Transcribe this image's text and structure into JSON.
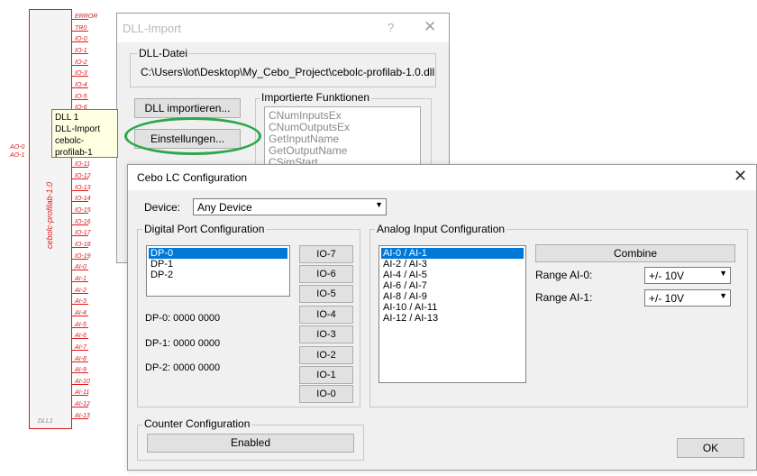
{
  "schematic": {
    "block_name": "cebolc-profilab-1.0",
    "footer": "DLL1",
    "right_pins": [
      "ERROR",
      "TR0",
      "IO-0",
      "IO-1",
      "IO-2",
      "IO-3",
      "IO-4",
      "IO-5",
      "IO-6",
      "IO-7",
      "IO-8",
      "IO-9",
      "IO-10",
      "IO-11",
      "IO-12",
      "IO-13",
      "IO-14",
      "IO-15",
      "IO-16",
      "IO-17",
      "IO-18",
      "IO-19",
      "AI-0",
      "AI-1",
      "AI-2",
      "AI-3",
      "AI-4",
      "AI-5",
      "AI-6",
      "AI-7",
      "AI-8",
      "AI-9",
      "AI-10",
      "AI-11",
      "AI-12",
      "AI-13"
    ],
    "left_pins": [
      "AO-0",
      "AO-1"
    ]
  },
  "tooltip": {
    "line1": "DLL 1",
    "line2": "DLL-Import",
    "line3": "cebolc-profilab-1"
  },
  "dll_dialog": {
    "title": "DLL-Import",
    "help": "?",
    "close": "✕",
    "file_group": "DLL-Datei",
    "path": "C:\\Users\\lot\\Desktop\\My_Cebo_Project\\cebolc-profilab-1.0.dll",
    "import_button": "DLL importieren...",
    "settings_button": "Einstellungen...",
    "functions_group": "Importierte Funktionen",
    "functions": [
      "CNumInputsEx",
      "CNumOutputsEx",
      "GetInputName",
      "GetOutputName",
      "CSimStart"
    ]
  },
  "cebo": {
    "title": "Cebo LC Configuration",
    "close": "✕",
    "device_label": "Device:",
    "device_value": "Any Device",
    "digital_group": "Digital Port Configuration",
    "dp_list": [
      "DP-0",
      "DP-1",
      "DP-2"
    ],
    "io_buttons": [
      "IO-7",
      "IO-6",
      "IO-5",
      "IO-4",
      "IO-3",
      "IO-2",
      "IO-1",
      "IO-0"
    ],
    "dp_states": [
      "DP-0: 0000 0000",
      "DP-1: 0000 0000",
      "DP-2: 0000 0000"
    ],
    "analog_group": "Analog Input Configuration",
    "ai_list": [
      "AI-0 / AI-1",
      "AI-2 / AI-3",
      "AI-4 / AI-5",
      "AI-6 / AI-7",
      "AI-8 / AI-9",
      "AI-10 / AI-11",
      "AI-12 / AI-13"
    ],
    "combine_button": "Combine",
    "range0_label": "Range AI-0:",
    "range0_value": "+/- 10V",
    "range1_label": "Range AI-1:",
    "range1_value": "+/- 10V",
    "counter_group": "Counter Configuration",
    "counter_button": "Enabled",
    "ok_button": "OK"
  },
  "colors": {
    "pin_red": "#e01818",
    "highlight_green": "#2ca84a",
    "selection_blue": "#0078d7"
  }
}
